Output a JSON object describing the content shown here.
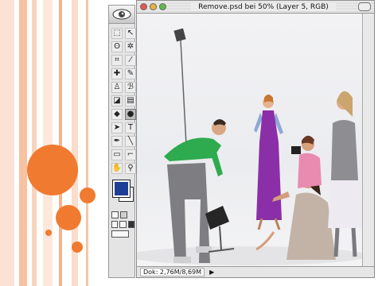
{
  "colors": {
    "slide_accent": "#f07a30",
    "stripe_light": "#fde3d5",
    "stripe_mid": "#f8b990",
    "foreground_swatch": "#1e3f95",
    "dress": "#8b2fa8",
    "shirt": "#2eaa4f"
  },
  "toolbox": {
    "header_icon": "eye-logo",
    "tools": [
      {
        "name": "marquee-tool-icon",
        "glyph": "⬚"
      },
      {
        "name": "move-tool-icon",
        "glyph": "↖"
      },
      {
        "name": "lasso-tool-icon",
        "glyph": "ʘ"
      },
      {
        "name": "magic-wand-tool-icon",
        "glyph": "✲"
      },
      {
        "name": "crop-tool-icon",
        "glyph": "⌗"
      },
      {
        "name": "slice-tool-icon",
        "glyph": "⁄"
      },
      {
        "name": "healing-brush-icon",
        "glyph": "✚"
      },
      {
        "name": "brush-tool-icon",
        "glyph": "✎"
      },
      {
        "name": "stamp-tool-icon",
        "glyph": "♙"
      },
      {
        "name": "history-brush-icon",
        "glyph": "ℬ"
      },
      {
        "name": "eraser-tool-icon",
        "glyph": "◪"
      },
      {
        "name": "gradient-tool-icon",
        "glyph": "▤"
      },
      {
        "name": "blur-tool-icon",
        "glyph": "◆"
      },
      {
        "name": "dodge-tool-icon",
        "glyph": "●"
      },
      {
        "name": "path-select-tool-icon",
        "glyph": "➤"
      },
      {
        "name": "type-tool-icon",
        "glyph": "T"
      },
      {
        "name": "pen-tool-icon",
        "glyph": "✒"
      },
      {
        "name": "line-tool-icon",
        "glyph": "╲"
      },
      {
        "name": "notes-tool-icon",
        "glyph": "▭"
      },
      {
        "name": "eyedropper-tool-icon",
        "glyph": "⌐"
      },
      {
        "name": "hand-tool-icon",
        "glyph": "✋"
      },
      {
        "name": "zoom-tool-icon",
        "glyph": "⚲"
      }
    ]
  },
  "document": {
    "title": "Remove.psd bei 50% (Layer 5, RGB)",
    "status_left": "Dok: 2,76M/8,69M"
  }
}
